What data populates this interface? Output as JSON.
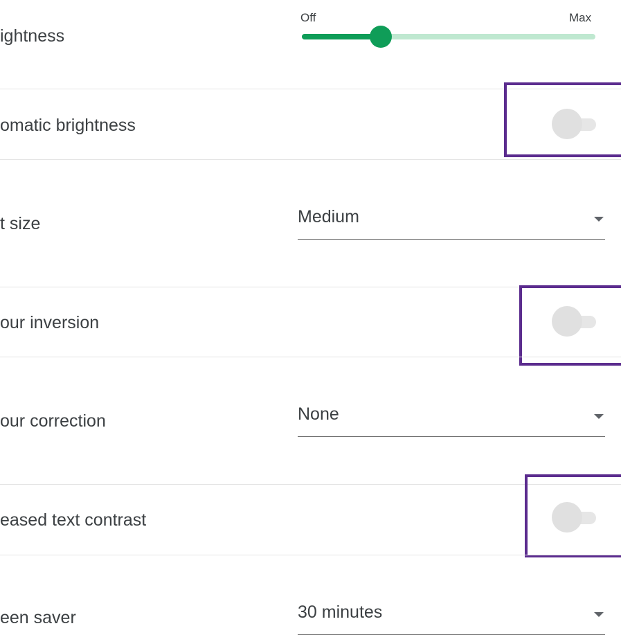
{
  "brightness": {
    "label": "ightness",
    "min_label": "Off",
    "max_label": "Max",
    "level": 0.27
  },
  "auto_brightness": {
    "label": "omatic brightness",
    "enabled": false
  },
  "text_size": {
    "label": "t size",
    "value": "Medium"
  },
  "colour_inversion": {
    "label": "our inversion",
    "enabled": false
  },
  "colour_correction": {
    "label": "our correction",
    "value": "None"
  },
  "text_contrast": {
    "label": "eased text contrast",
    "enabled": false
  },
  "screen_saver": {
    "label": "een saver",
    "value": "30 minutes"
  },
  "colors": {
    "accent": "#0f9d58",
    "accent_light": "#bfe8d0",
    "highlight": "#5b2c8e"
  }
}
